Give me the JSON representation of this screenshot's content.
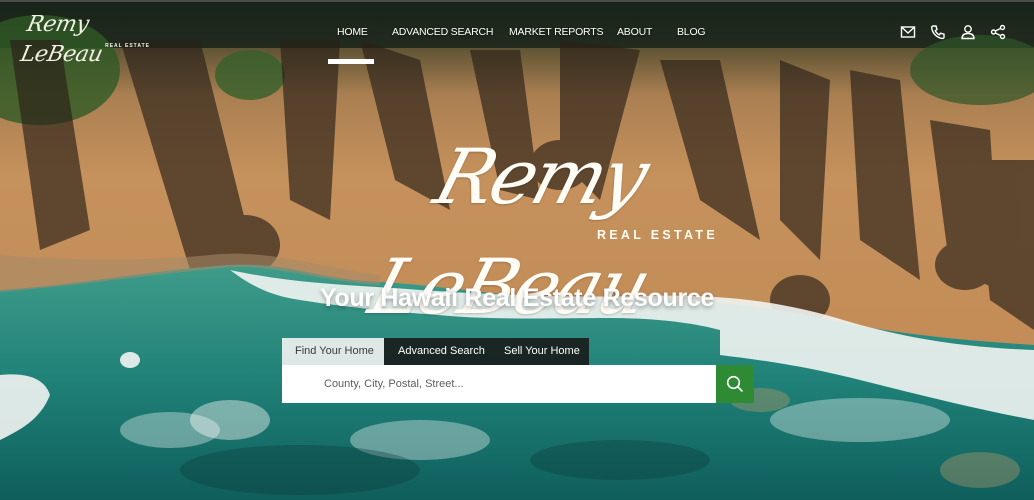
{
  "site": {
    "logo_script": "Remy LeBeau",
    "logo_sub": "REAL ESTATE"
  },
  "nav": {
    "items": [
      {
        "label": "HOME",
        "active": true
      },
      {
        "label": "ADVANCED SEARCH",
        "active": false
      },
      {
        "label": "MARKET REPORTS",
        "active": false
      },
      {
        "label": "ABOUT",
        "active": false
      },
      {
        "label": "BLOG",
        "active": false
      }
    ]
  },
  "header_icons": [
    {
      "name": "mail-icon",
      "glyph": "envelope"
    },
    {
      "name": "phone-icon",
      "glyph": "phone"
    },
    {
      "name": "user-icon",
      "glyph": "person"
    },
    {
      "name": "share-icon",
      "glyph": "share"
    }
  ],
  "hero": {
    "brand_script": "Remy LeBeau",
    "brand_sub": "REAL ESTATE",
    "tagline": "Your Hawaii Real Estate Resource"
  },
  "search": {
    "tabs": [
      {
        "label": "Find Your Home",
        "active": true
      },
      {
        "label": "Advanced Search",
        "active": false
      },
      {
        "label": "Sell Your Home",
        "active": false
      }
    ],
    "input_value": "",
    "placeholder": "County, City, Postal, Street...",
    "button_icon": "search-icon"
  },
  "colors": {
    "accent_green": "#2e8b33",
    "tab_dark": "#181818",
    "tab_active": "#eef0ee",
    "text_light": "#ffffff"
  }
}
